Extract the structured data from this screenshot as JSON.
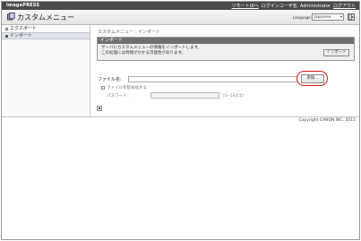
{
  "app": {
    "brand": "imagePRESS",
    "title": "カスタムメニュー"
  },
  "topnav": {
    "links": [
      "リモートUIへ",
      "ログインユーザ名: Administrator",
      "ログアウト"
    ]
  },
  "language": {
    "label": "Language:",
    "value": "Japanese",
    "dropdown_icon": "chevron-down-icon"
  },
  "sidebar": {
    "items": [
      {
        "label": "エクスポート",
        "icon": "square-hollow-icon",
        "active": false
      },
      {
        "label": "インポート",
        "icon": "square-filled-icon",
        "active": true
      }
    ]
  },
  "main": {
    "breadcrumb": "カスタムメニュー : インポート",
    "panel": {
      "title": "インポート",
      "desc_line1": "サーバにカスタムメニューの情報をインポートします。",
      "desc_line2": "この処理には時間がかかる可能性があります。",
      "import_button": "インポート"
    },
    "file": {
      "label": "ファイル名:",
      "value": "",
      "browse_button": "参照..."
    },
    "encrypt": {
      "label": "ファイルを暗号化する"
    },
    "password": {
      "label": "パスワード:",
      "note": "(4〜16文字)"
    }
  },
  "footer": {
    "copyright": "Copyright CANON INC. 2015"
  },
  "colors": {
    "topbar": "#4a4a4a",
    "panel_head": "#6f6f6f",
    "highlight_ring": "#d21e1e"
  }
}
